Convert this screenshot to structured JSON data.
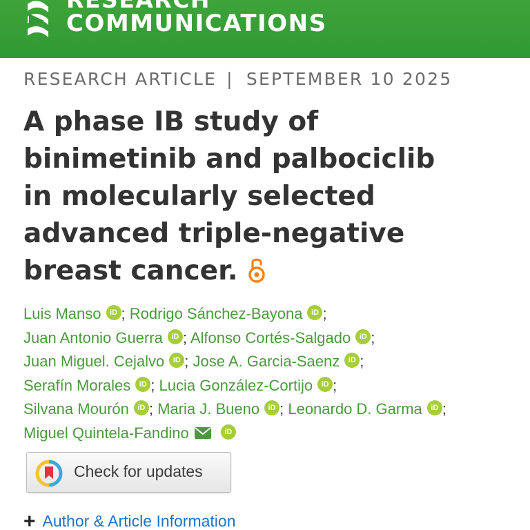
{
  "header": {
    "journal_line1": "RESEARCH",
    "journal_line2": "COMMUNICATIONS",
    "logo_icon": "journal-logo-icon",
    "background_color": "#35a035"
  },
  "article": {
    "type": "RESEARCH ARTICLE",
    "separator": "|",
    "date": "SEPTEMBER 10 2025",
    "title_lines": [
      "A phase IB study of",
      "binimetinib and palbociclib",
      "in molecularly selected",
      "advanced triple-negative",
      "breast cancer."
    ],
    "open_access_icon": "open-access-lock-icon"
  },
  "authors": {
    "separator": ";",
    "rows": [
      [
        {
          "name": "Luis Manso",
          "orcid": true,
          "sep": true
        },
        {
          "name": "Rodrigo Sánchez-Bayona",
          "orcid": true,
          "sep": true
        }
      ],
      [
        {
          "name": "Juan Antonio Guerra",
          "orcid": true,
          "sep": true
        },
        {
          "name": "Alfonso Cortés-Salgado",
          "orcid": true,
          "sep": true
        }
      ],
      [
        {
          "name": "Juan Miguel. Cejalvo",
          "orcid": true,
          "sep": true
        },
        {
          "name": "Jose A. Garcia-Saenz",
          "orcid": true,
          "sep": true
        }
      ],
      [
        {
          "name": "Serafín Morales",
          "orcid": true,
          "sep": true
        },
        {
          "name": "Lucia González-Cortijo",
          "orcid": true,
          "sep": true
        }
      ],
      [
        {
          "name": "Silvana Mourón",
          "orcid": true,
          "sep": true
        },
        {
          "name": "Maria J. Bueno",
          "orcid": true,
          "sep": true
        },
        {
          "name": "Leonardo D. Garma",
          "orcid": true,
          "sep": true
        }
      ],
      [
        {
          "name": "Miguel Quintela-Fandino",
          "orcid": true,
          "sep": false,
          "mail": true
        }
      ]
    ],
    "name_color": "#4a9a3c",
    "orcid_color": "#a6ce39"
  },
  "check_updates": {
    "label": "Check for updates",
    "icon": "crossmark-icon"
  },
  "info": {
    "icon": "plus-icon",
    "label": "Author & Article Information",
    "link_color": "#1a73c9"
  }
}
